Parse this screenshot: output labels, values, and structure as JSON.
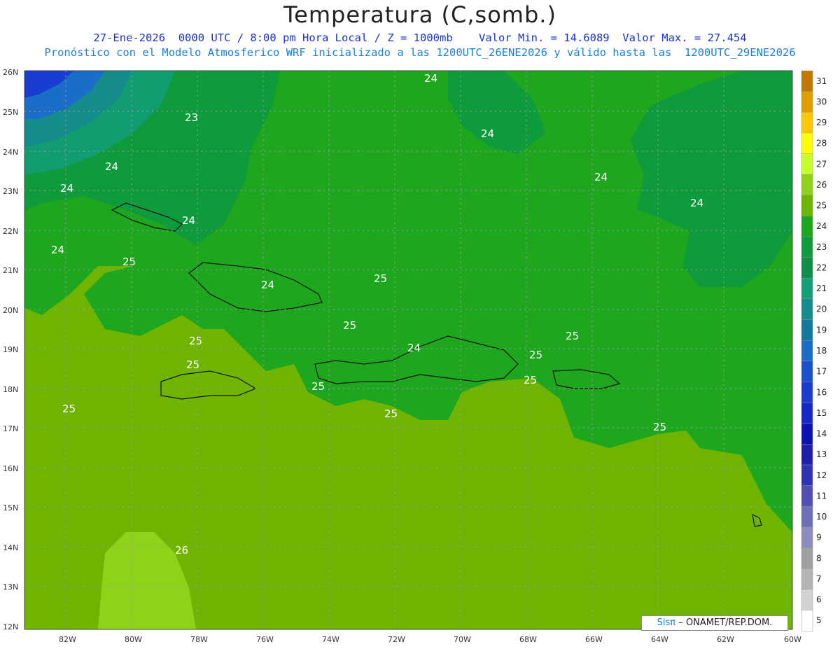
{
  "header": {
    "title": "Temperatura (C,somb.)",
    "line1": "27-Ene-2026  0000 UTC / 8:00 pm Hora Local / Z = 1000mb    Valor Min. = 14.6089  Valor Max. = 27.454",
    "line2": "Pronóstico con el Modelo Atmosferico WRF inicializado a las 1200UTC_26ENE2026 y válido hasta las  1200UTC_29ENE2026"
  },
  "map": {
    "lat_labels": [
      "26N",
      "25N",
      "24N",
      "23N",
      "22N",
      "21N",
      "20N",
      "19N",
      "18N",
      "17N",
      "16N",
      "15N",
      "14N",
      "13N",
      "12N"
    ],
    "lon_labels": [
      "82W",
      "80W",
      "78W",
      "76W",
      "74W",
      "72W",
      "70W",
      "68W",
      "66W",
      "64W",
      "62W",
      "60W"
    ],
    "contour_labels": [
      "24",
      "23",
      "24",
      "24",
      "24",
      "24",
      "24",
      "24",
      "24",
      "25",
      "25",
      "24",
      "25",
      "25",
      "25",
      "25",
      "25",
      "25",
      "25",
      "25",
      "25",
      "25",
      "26",
      "24"
    ],
    "colors": {
      "t26": "#8ed31a",
      "t25": "#6fb400",
      "t24": "#1ea61e",
      "t23": "#0f9a3c",
      "t22": "#119d6f",
      "t20": "#148c8c",
      "t18": "#1a6ec8",
      "t16": "#1a3cd0"
    }
  },
  "colorbar": {
    "levels": [
      "31",
      "30",
      "29",
      "28",
      "27",
      "26",
      "25",
      "24",
      "23",
      "22",
      "21",
      "20",
      "19",
      "18",
      "17",
      "16",
      "15",
      "14",
      "13",
      "12",
      "11",
      "10",
      "9",
      "8",
      "7",
      "6",
      "5"
    ],
    "colors": [
      "#c07800",
      "#e09c00",
      "#ffc800",
      "#ffff00",
      "#c8ff28",
      "#8ed31a",
      "#6fb400",
      "#1ea61e",
      "#0f9a3c",
      "#118f4a",
      "#11a07a",
      "#148c8c",
      "#1478a0",
      "#1a6ec8",
      "#1a50d0",
      "#1a3cd0",
      "#1428c8",
      "#0a14b4",
      "#1e1eaa",
      "#3232b4",
      "#5050b4",
      "#6e6eb4",
      "#8c8cbe",
      "#a0a0a0",
      "#b4b4b4",
      "#d2d2d2",
      "#ffffff"
    ]
  },
  "credit": {
    "brand": "Sisπ",
    "text": "– ONAMET/REP.DOM."
  }
}
